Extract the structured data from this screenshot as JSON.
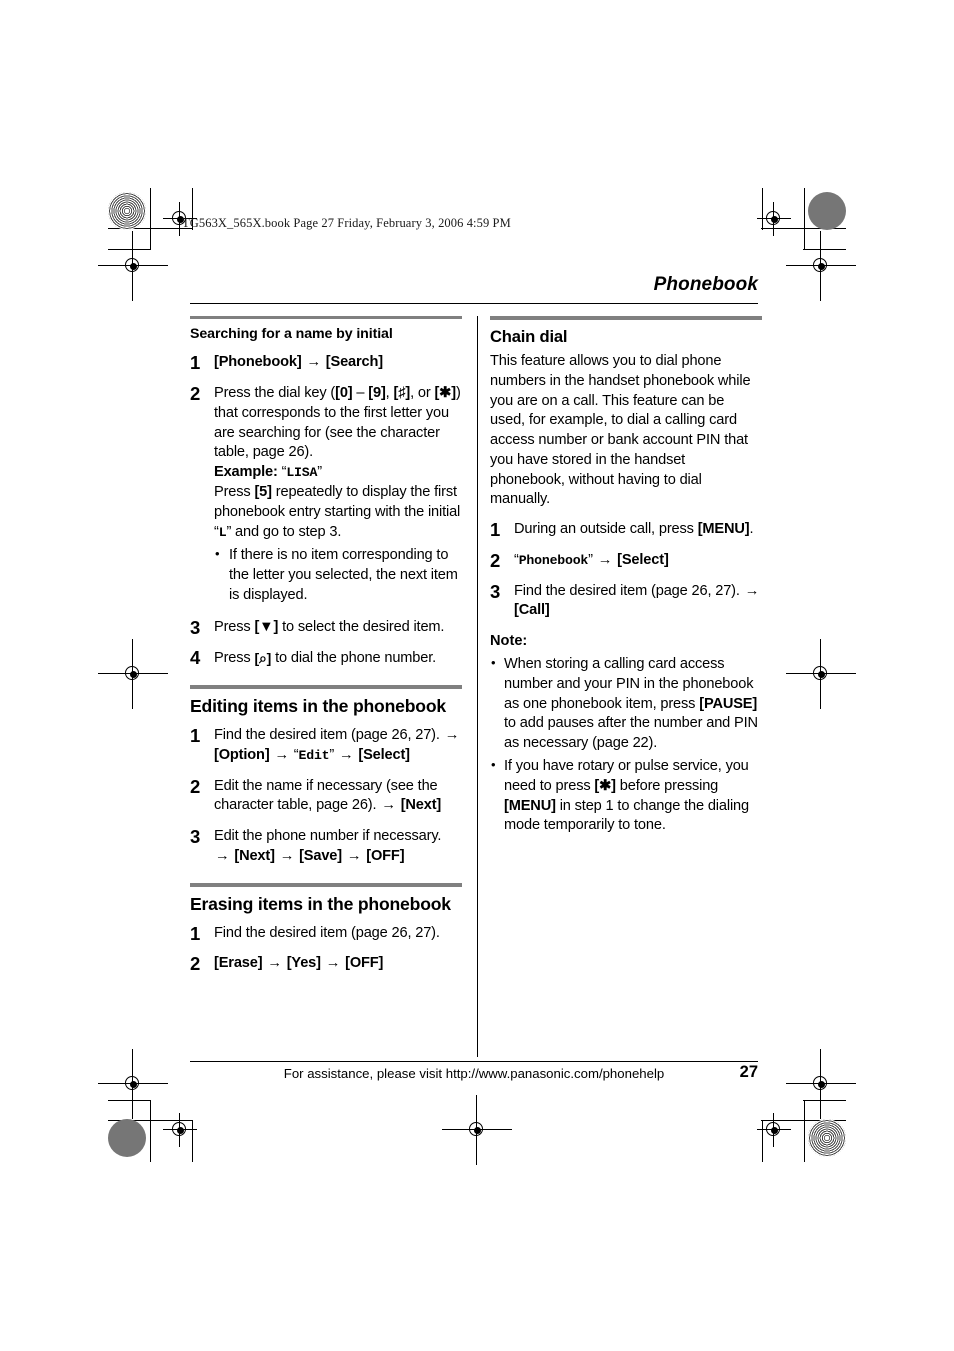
{
  "printer_marks": {
    "filestamp": "TG563X_565X.book  Page 27  Friday, February 3, 2006  4:59 PM"
  },
  "header": {
    "running_head": "Phonebook"
  },
  "footer": {
    "assistance": "For assistance, please visit http://www.panasonic.com/phonehelp",
    "page_number": "27"
  },
  "left_column": {
    "searching": {
      "heading": "Searching for a name by initial",
      "step1": {
        "num": "1",
        "key_phonebook": "[Phonebook]",
        "arrow": "→",
        "key_search": "[Search]"
      },
      "step2": {
        "num": "2",
        "text_a": "Press the dial key (",
        "key_0": "[0]",
        "dash": " – ",
        "key_9": "[9]",
        "comma_a": ", ",
        "key_hash": "[♯]",
        "text_b": ", or ",
        "key_star": "[✱]",
        "text_c": ") that corresponds to the first letter you are searching for (see the character table, page 26).",
        "example_label": "Example:",
        "example_value": "LISA",
        "text_d": "Press ",
        "key_5": "[5]",
        "text_e": " repeatedly to display the first phonebook entry starting with the initial “",
        "initial_letter": "L",
        "text_f": "” and go to step 3.",
        "bullet": "If there is no item corresponding to the letter you selected, the next item is displayed."
      },
      "step3": {
        "num": "3",
        "text_a": "Press ",
        "key_down": "[▼]",
        "text_b": " to select the desired item."
      },
      "step4": {
        "num": "4",
        "text_a": "Press ",
        "key_talk": "[⌕]",
        "text_b": " to dial the phone number."
      }
    },
    "editing": {
      "heading": "Editing items in the phonebook",
      "step1": {
        "num": "1",
        "text_a": "Find the desired item (page 26, 27). ",
        "arrow1": "→",
        "key_option": "[Option]",
        "arrow2": "→",
        "display_edit": "Edit",
        "arrow3": "→",
        "key_select": "[Select]"
      },
      "step2": {
        "num": "2",
        "text_a": "Edit the name if necessary (see the character table, page 26). ",
        "arrow": "→",
        "key_next": "[Next]"
      },
      "step3": {
        "num": "3",
        "text_a": "Edit the phone number if necessary.",
        "arrow1": "→",
        "key_next": "[Next]",
        "arrow2": "→",
        "key_save": "[Save]",
        "arrow3": "→",
        "key_off": "[OFF]"
      }
    },
    "erasing": {
      "heading": "Erasing items in the phonebook",
      "step1": {
        "num": "1",
        "text_a": "Find the desired item (page 26, 27)."
      },
      "step2": {
        "num": "2",
        "key_erase": "[Erase]",
        "arrow1": "→",
        "key_yes": "[Yes]",
        "arrow2": "→",
        "key_off": "[OFF]"
      }
    }
  },
  "right_column": {
    "chain_dial": {
      "heading": "Chain dial",
      "intro": "This feature allows you to dial phone numbers in the handset phonebook while you are on a call. This feature can be used, for example, to dial a calling card access number or bank account PIN that you have stored in the handset phonebook, without having to dial manually.",
      "step1": {
        "num": "1",
        "text_a": "During an outside call, press ",
        "key_menu": "[MENU]",
        "text_b": "."
      },
      "step2": {
        "num": "2",
        "display_phonebook": "Phonebook",
        "arrow": "→",
        "key_select": "[Select]"
      },
      "step3": {
        "num": "3",
        "text_a": "Find the desired item (page 26, 27). ",
        "arrow": "→",
        "key_call": "[Call]"
      },
      "note_label": "Note:",
      "note_bullets": [
        {
          "text_a": "When storing a calling card access number and your PIN in the phonebook as one phonebook item, press ",
          "key": "[PAUSE]",
          "text_b": " to add pauses after the number and PIN as necessary (page 22)."
        },
        {
          "text_a": "If you have rotary or pulse service, you need to press ",
          "key": "[✱]",
          "text_b": " before pressing ",
          "key2": "[MENU]",
          "text_c": " in step 1 to change the dialing mode temporarily to tone."
        }
      ]
    }
  }
}
